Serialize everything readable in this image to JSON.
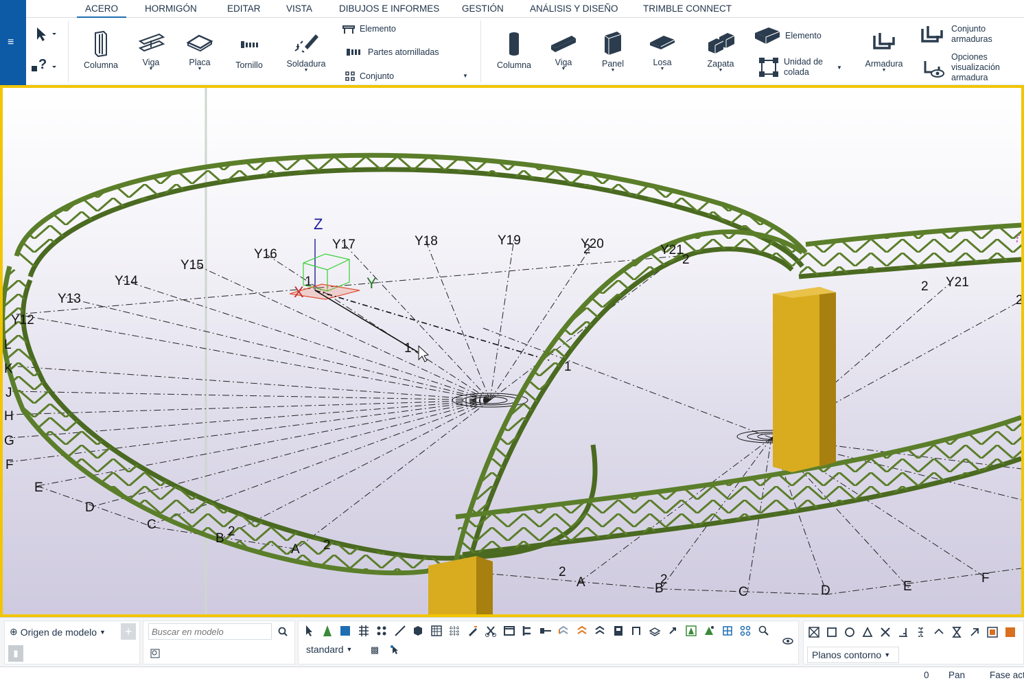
{
  "menu": {
    "icon": "hamburger-menu-icon",
    "glyph": "≡"
  },
  "tabs": [
    {
      "label": "ACERO",
      "active": true
    },
    {
      "label": "HORMIGÓN"
    },
    {
      "label": "EDITAR"
    },
    {
      "label": "VISTA"
    },
    {
      "label": "DIBUJOS E INFORMES"
    },
    {
      "label": "GESTIÓN"
    },
    {
      "label": "ANÁLISIS Y DISEÑO"
    },
    {
      "label": "TRIMBLE CONNECT"
    }
  ],
  "ribbon": {
    "steel": {
      "columna": "Columna",
      "viga": "Viga",
      "placa": "Placa",
      "tornillo": "Tornillo",
      "soldadura": "Soldadura",
      "elemento": "Elemento",
      "partes_atornilladas": "Partes atornilladas",
      "conjunto": "Conjunto"
    },
    "concrete": {
      "columna": "Columna",
      "viga": "Viga",
      "panel": "Panel",
      "losa": "Losa",
      "zapata": "Zapata",
      "elemento": "Elemento",
      "unidad_colada_line1": "Unidad de",
      "unidad_colada_line2": "colada",
      "armadura": "Armadura",
      "conjunto_armaduras_line1": "Conjunto",
      "conjunto_armaduras_line2": "armaduras",
      "opciones_line1": "Opciones",
      "opciones_line2": "visualización",
      "opciones_line3": "armadura"
    }
  },
  "viewport": {
    "axis_z": "Z",
    "axis_x": "X",
    "axis_y": "Y",
    "grid_y": [
      "Y12",
      "Y13",
      "Y14",
      "Y15",
      "Y16",
      "Y17",
      "Y18",
      "Y19",
      "Y20",
      "Y21",
      "Y21"
    ],
    "grid_letters_left": [
      "L",
      "K",
      "J",
      "H",
      "G",
      "F",
      "E",
      "D",
      "C",
      "B",
      "A"
    ],
    "grid_letters_right": [
      "A",
      "B",
      "C",
      "D",
      "E",
      "F"
    ],
    "level_marks": [
      "1",
      "1",
      "1",
      "2",
      "2",
      "2",
      "2",
      "2",
      "2",
      "2",
      "2"
    ],
    "colors": {
      "truss": "#5b7e2a",
      "truss_dark": "#4a6a21",
      "column": "#d9ac20",
      "column_dark": "#a88010",
      "frame": "#f2c500"
    }
  },
  "bottom": {
    "origin_dropdown": "Origen de modelo",
    "search_placeholder": "Buscar en modelo",
    "filter_dropdown": "standard",
    "planes_dropdown": "Planos contorno"
  },
  "status": {
    "count": "0",
    "mode": "Pan",
    "phase": "Fase act"
  }
}
